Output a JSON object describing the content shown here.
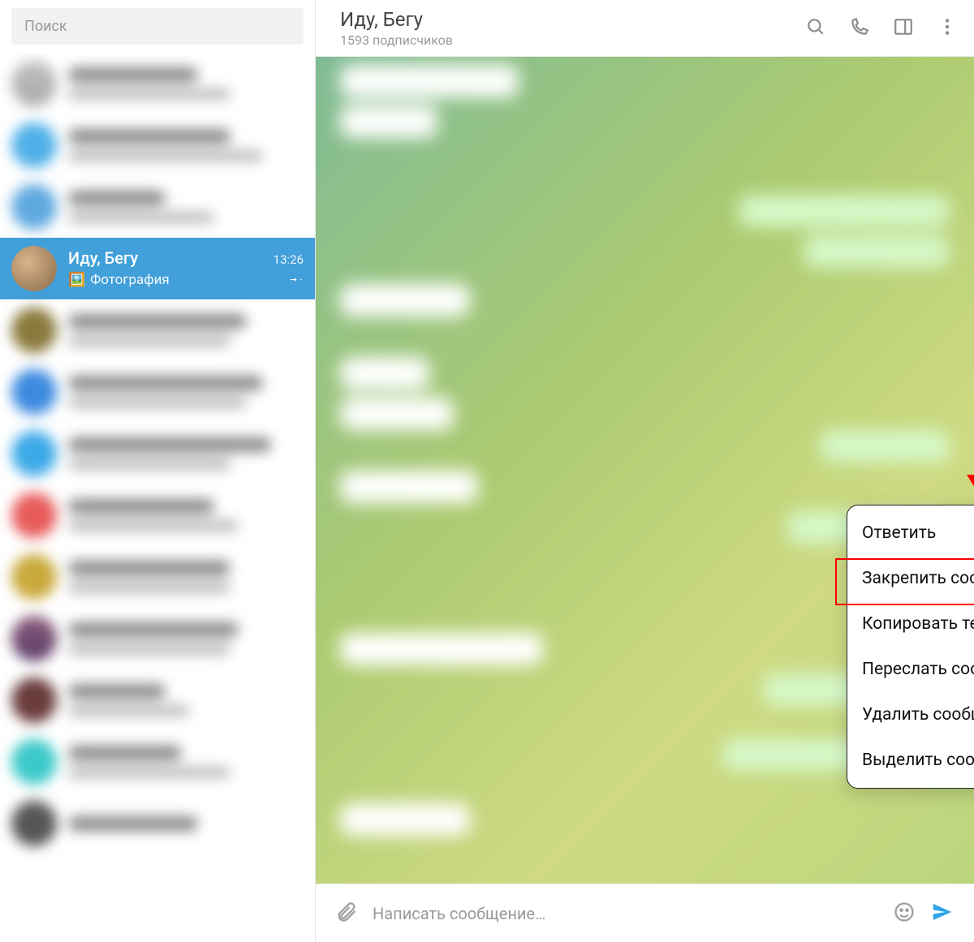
{
  "search": {
    "placeholder": "Поиск"
  },
  "active_chat": {
    "name": "Иду, Бегу",
    "time": "13:26",
    "preview": "Фотография",
    "preview_icon": "photo-icon"
  },
  "header": {
    "title": "Иду, Бегу",
    "subtitle": "1593 подписчиков"
  },
  "context_menu": {
    "items": [
      "Ответить",
      "Закрепить сообщение",
      "Копировать текст",
      "Переслать сообщение",
      "Удалить сообщение",
      "Выделить сообщение"
    ],
    "highlighted_index": 1
  },
  "compose": {
    "placeholder": "Написать сообщение…"
  },
  "icons": {
    "search": "search-icon",
    "call": "phone-icon",
    "panel": "panel-icon",
    "more": "more-icon",
    "attach": "paperclip-icon",
    "emoji": "emoji-icon",
    "send": "send-icon",
    "pin": "pin-icon"
  }
}
